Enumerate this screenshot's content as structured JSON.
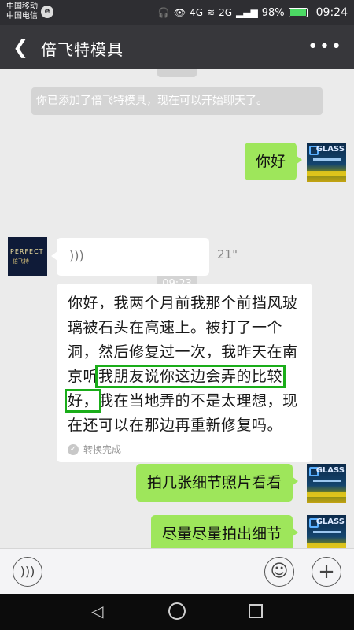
{
  "status_bar": {
    "carrier_1": "中国移动",
    "carrier_2": "中国电信",
    "network_1": "4G",
    "network_2": "2G",
    "battery": "98%",
    "time": "09:24"
  },
  "header": {
    "title": "倍飞特模具"
  },
  "chat": {
    "system_message": "你已添加了倍飞特模具，现在可以开始聊天了。",
    "time_badge": "09:23",
    "messages": [
      {
        "side": "right",
        "type": "text",
        "text": "你好"
      },
      {
        "side": "left",
        "type": "voice",
        "duration": "21\""
      },
      {
        "side": "left",
        "type": "transcript",
        "text_before": "你好，我两个月前我那个前挡风玻璃被石头在高速上。被打了一个洞，然后修复过一次，我昨天在南京听",
        "text_highlight": "我朋友说你这边会弄的比较好，",
        "text_after": "我在当地弄的不是太理想，现在还可以在那边再重新修复吗。",
        "status": "转换完成"
      },
      {
        "side": "right",
        "type": "text",
        "text": "拍几张细节照片看看"
      },
      {
        "side": "right",
        "type": "text",
        "text": "尽量尽量拍出细节"
      }
    ]
  },
  "avatars": {
    "self_label": "GLASS",
    "contact_label_1": "PERFECT",
    "contact_label_2": "倍飞特"
  },
  "colors": {
    "header_bg": "#37373b",
    "chat_bg": "#ebebeb",
    "bubble_self": "#9ee65b",
    "highlight_box": "#1aad19"
  }
}
